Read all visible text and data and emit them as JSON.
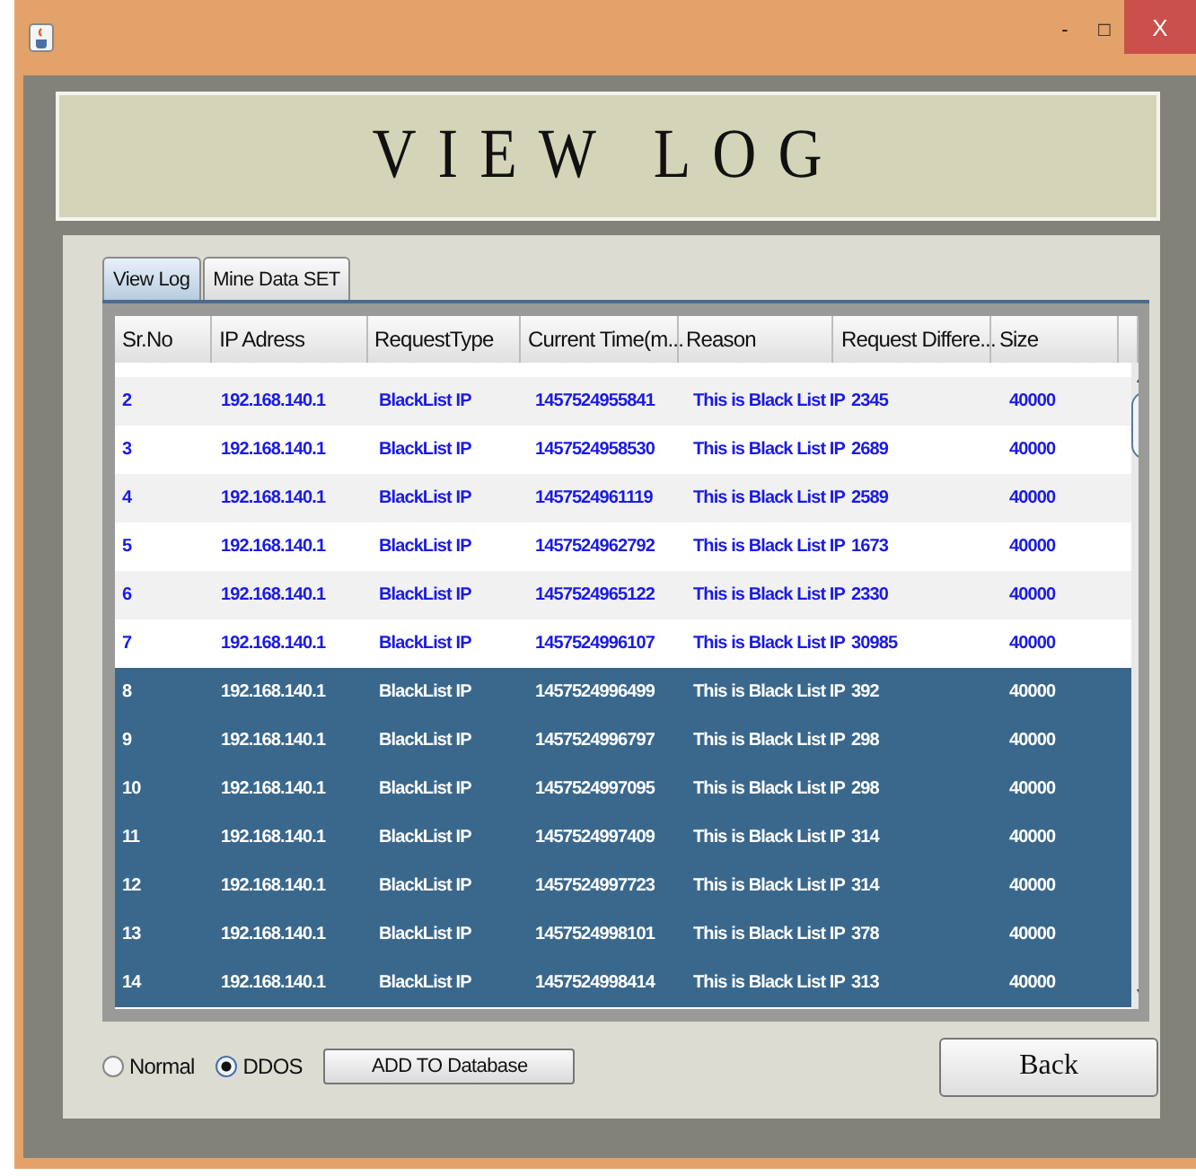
{
  "window": {
    "controls": {
      "minimize": "-",
      "maximize": "□",
      "close": "X"
    }
  },
  "header": {
    "title": "VIEW LOG"
  },
  "tabs": [
    {
      "label": "View Log",
      "selected": true
    },
    {
      "label": "Mine Data SET",
      "selected": false
    }
  ],
  "table": {
    "columns": [
      "Sr.No",
      "IP Adress",
      "RequestType",
      "Current Time(m...",
      "Reason",
      "Request Differe...",
      "Size"
    ],
    "rows": [
      {
        "cells": [
          "2",
          "192.168.140.1",
          "BlackList IP",
          "1457524955841",
          "This is Black List IP",
          "2345",
          "40000"
        ],
        "selected": false
      },
      {
        "cells": [
          "3",
          "192.168.140.1",
          "BlackList IP",
          "1457524958530",
          "This is Black List IP",
          "2689",
          "40000"
        ],
        "selected": false
      },
      {
        "cells": [
          "4",
          "192.168.140.1",
          "BlackList IP",
          "1457524961119",
          "This is Black List IP",
          "2589",
          "40000"
        ],
        "selected": false
      },
      {
        "cells": [
          "5",
          "192.168.140.1",
          "BlackList IP",
          "1457524962792",
          "This is Black List IP",
          "1673",
          "40000"
        ],
        "selected": false
      },
      {
        "cells": [
          "6",
          "192.168.140.1",
          "BlackList IP",
          "1457524965122",
          "This is Black List IP",
          "2330",
          "40000"
        ],
        "selected": false
      },
      {
        "cells": [
          "7",
          "192.168.140.1",
          "BlackList IP",
          "1457524996107",
          "This is Black List IP",
          "30985",
          "40000"
        ],
        "selected": false
      },
      {
        "cells": [
          "8",
          "192.168.140.1",
          "BlackList IP",
          "1457524996499",
          "This is Black List IP",
          "392",
          "40000"
        ],
        "selected": true
      },
      {
        "cells": [
          "9",
          "192.168.140.1",
          "BlackList IP",
          "1457524996797",
          "This is Black List IP",
          "298",
          "40000"
        ],
        "selected": true
      },
      {
        "cells": [
          "10",
          "192.168.140.1",
          "BlackList IP",
          "1457524997095",
          "This is Black List IP",
          "298",
          "40000"
        ],
        "selected": true
      },
      {
        "cells": [
          "11",
          "192.168.140.1",
          "BlackList IP",
          "1457524997409",
          "This is Black List IP",
          "314",
          "40000"
        ],
        "selected": true
      },
      {
        "cells": [
          "12",
          "192.168.140.1",
          "BlackList IP",
          "1457524997723",
          "This is Black List IP",
          "314",
          "40000"
        ],
        "selected": true
      },
      {
        "cells": [
          "13",
          "192.168.140.1",
          "BlackList IP",
          "1457524998101",
          "This is Black List IP",
          "378",
          "40000"
        ],
        "selected": true
      },
      {
        "cells": [
          "14",
          "192.168.140.1",
          "BlackList IP",
          "1457524998414",
          "This is Black List IP",
          "313",
          "40000"
        ],
        "selected": true
      }
    ]
  },
  "mode": [
    {
      "label": "Normal",
      "selected": false
    },
    {
      "label": "DDOS",
      "selected": true
    }
  ],
  "buttons": {
    "add": "ADD TO Database",
    "back": "Back"
  }
}
